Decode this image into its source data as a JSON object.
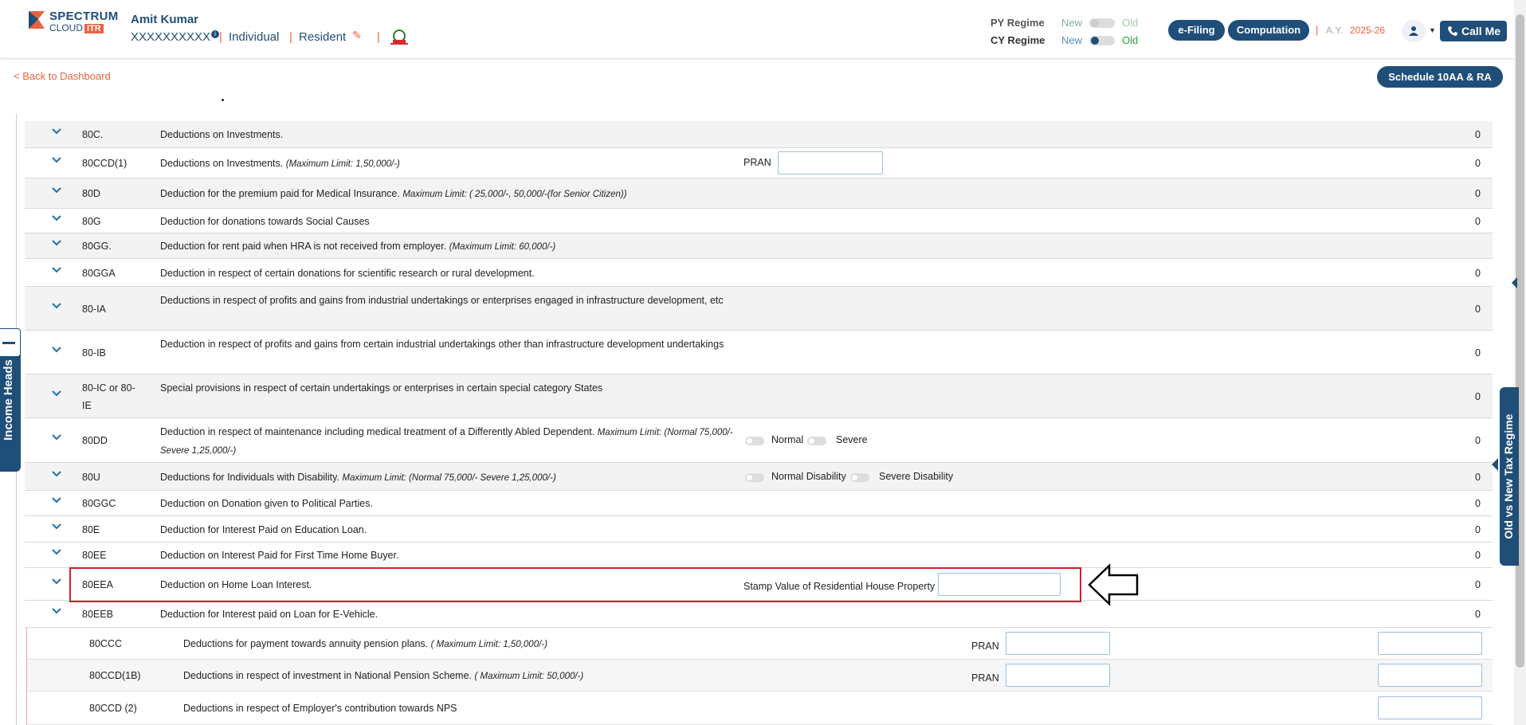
{
  "header": {
    "logo_line1": "SPECTRUM",
    "logo_line2": "CLOUD",
    "logo_badge": "ITR",
    "user_name": "Amit Kumar",
    "pan": "XXXXXXXXXX",
    "pan_info_icon": "info-icon",
    "status": "Individual",
    "residency": "Resident",
    "edit_icon": "pencil-icon",
    "emblem_icon": "govt-emblem-icon",
    "py_regime_label": "PY Regime",
    "cy_regime_label": "CY Regime",
    "new_label": "New",
    "old_label": "Old",
    "efiling_label": "e-Filing",
    "computation_label": "Computation",
    "ay_label": "A.Y.",
    "ay_value": "2025-26",
    "avatar_icon": "user-icon",
    "call_label": "Call Me",
    "call_icon": "phone-icon"
  },
  "nav": {
    "back_label": "< Back to Dashboard",
    "schedule_label": "Schedule 10AA & RA"
  },
  "side_tabs": {
    "left": "Income Heads",
    "right": "Old vs New Tax Regime"
  },
  "deductions": [
    {
      "section": "80C.",
      "description": "Deductions on Investments.",
      "note": "",
      "amount": "0"
    },
    {
      "section": "80CCD(1)",
      "description": "Deductions on Investments.",
      "note": "(Maximum Limit: 1,50,000/-)",
      "amount": "0",
      "field_label": "PRAN"
    },
    {
      "section": "80D",
      "description": "Deduction for the premium paid for Medical Insurance.",
      "note": "Maximum Limit: ( 25,000/-, 50,000/-(for Senior Citizen))",
      "amount": "0"
    },
    {
      "section": "80G",
      "description": "Deduction for donations towards Social Causes",
      "note": "",
      "amount": "0"
    },
    {
      "section": "80GG.",
      "description": "Deduction for rent paid when HRA is not received from employer.",
      "note": "(Maximum Limit: 60,000/-)",
      "amount": ""
    },
    {
      "section": "80GGA",
      "description": "Deduction in respect of certain donations for scientific research or rural development.",
      "note": "",
      "amount": "0"
    },
    {
      "section": "80-IA",
      "description": "Deductions in respect of profits and gains from industrial undertakings or enterprises engaged in infrastructure development, etc",
      "note": "",
      "amount": "0"
    },
    {
      "section": "80-IB",
      "description": "Deduction in respect of profits and gains from certain industrial undertakings other than infrastructure development undertakings",
      "note": "",
      "amount": "0"
    },
    {
      "section": "80-IC or 80-IE",
      "description": "Special provisions in respect of certain undertakings or enterprises in certain special category States",
      "note": "",
      "amount": "0"
    },
    {
      "section": "80DD",
      "description": "Deduction in respect of maintenance including medical treatment of a Differently Abled Dependent.",
      "note": "Maximum Limit: (Normal 75,000/- Severe 1,25,000/-)",
      "amount": "0",
      "toggle1": "Normal",
      "toggle2": "Severe"
    },
    {
      "section": "80U",
      "description": "Deductions for Individuals with Disability.",
      "note": "Maximum Limit: (Normal 75,000/- Severe 1,25,000/-)",
      "amount": "0",
      "toggle1": "Normal Disability",
      "toggle2": "Severe Disability"
    },
    {
      "section": "80GGC",
      "description": "Deduction on Donation given to Political Parties.",
      "note": "",
      "amount": "0"
    },
    {
      "section": "80E",
      "description": "Deduction for Interest Paid on Education Loan.",
      "note": "",
      "amount": "0"
    },
    {
      "section": "80EE",
      "description": "Deduction on Interest Paid for First Time Home Buyer.",
      "note": "",
      "amount": "0"
    },
    {
      "section": "80EEA",
      "description": "Deduction on Home Loan Interest.",
      "note": "",
      "amount": "0",
      "field_label": "Stamp Value of Residential House Property"
    },
    {
      "section": "80EEB",
      "description": "Deduction for Interest paid on Loan for E-Vehicle.",
      "note": "",
      "amount": "0"
    }
  ],
  "sub_deductions": [
    {
      "section": "80CCC",
      "description": "Deductions for payment towards annuity pension plans.",
      "note": "( Maximum Limit: 1,50,000/-)",
      "field_label": "PRAN"
    },
    {
      "section": "80CCD(1B)",
      "description": "Deductions in respect of investment in National Pension Scheme.",
      "note": "( Maximum Limit: 50,000/-)",
      "field_label": "PRAN"
    },
    {
      "section": "80CCD (2)",
      "description": "Deductions in respect of Employer's contribution towards NPS",
      "note": ""
    }
  ],
  "colors": {
    "primary": "#1f4e79",
    "accent": "#e9623f",
    "highlight": "#d21f2e"
  }
}
